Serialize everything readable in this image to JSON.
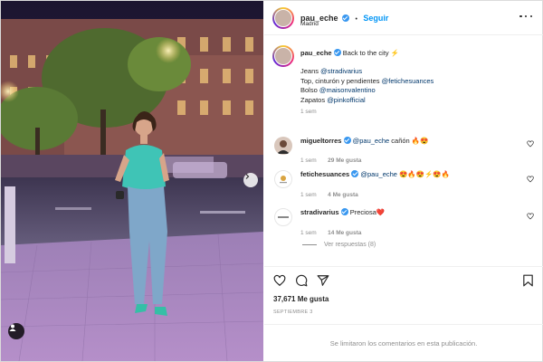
{
  "post": {
    "author": {
      "username": "pau_eche",
      "follow_label": "Seguir",
      "separator": "•",
      "location": "Madrid"
    },
    "caption": {
      "text": "Back to the city",
      "emoji": "⚡",
      "lines": [
        {
          "prefix": "Jeans ",
          "mention": "@stradivarius"
        },
        {
          "prefix": "Top, cinturón y pendientes ",
          "mention": "@fetichesuances"
        },
        {
          "prefix": "Bolso ",
          "mention": "@maisonvalentino"
        },
        {
          "prefix": "Zapatos ",
          "mention": "@pinkofficial"
        }
      ],
      "time": "1 sem"
    },
    "comments": [
      {
        "username": "migueltorres",
        "verified": true,
        "mention": "@pau_eche",
        "text": " cañón 🔥😍",
        "time": "1 sem",
        "likes": "29 Me gusta",
        "reply": ""
      },
      {
        "username": "fetichesuances",
        "verified": true,
        "mention": "@pau_eche",
        "text": " 😍🔥😍⚡😍🔥",
        "time": "1 sem",
        "likes": "4 Me gusta",
        "reply": ""
      },
      {
        "username": "stradivarius",
        "verified": true,
        "mention": "",
        "text": "Preciosa❤️",
        "time": "1 sem",
        "likes": "14 Me gusta",
        "reply": "Ver respuestas (8)"
      }
    ],
    "likes": "37,671 Me gusta",
    "date": "SEPTIEMBRE 3",
    "comments_disabled": "Se limitaron los comentarios en esta publicación.",
    "more_icon": "more-horizontal-icon",
    "icons": [
      "heart-icon",
      "comment-icon",
      "share-icon",
      "bookmark-icon",
      "chevron-right-icon",
      "tagged-user-icon"
    ],
    "colors": {
      "accent": "#0095f6",
      "verified": "#3897f0",
      "muted": "#8e8e8e"
    }
  }
}
